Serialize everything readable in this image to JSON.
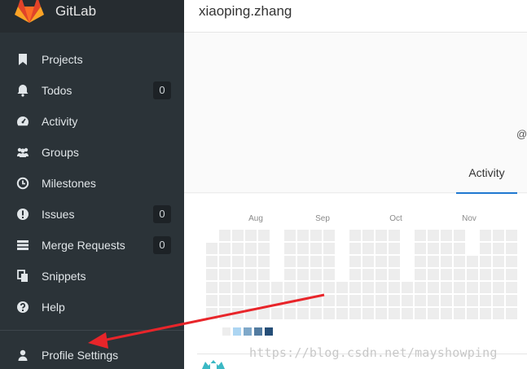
{
  "app": {
    "name": "GitLab"
  },
  "sidebar": {
    "items": [
      {
        "label": "Projects",
        "icon": "bookmark-icon",
        "badge": null
      },
      {
        "label": "Todos",
        "icon": "bell-icon",
        "badge": "0"
      },
      {
        "label": "Activity",
        "icon": "dashboard-icon",
        "badge": null
      },
      {
        "label": "Groups",
        "icon": "users-icon",
        "badge": null
      },
      {
        "label": "Milestones",
        "icon": "clock-icon",
        "badge": null
      },
      {
        "label": "Issues",
        "icon": "exclamation-circle-icon",
        "badge": "0"
      },
      {
        "label": "Merge Requests",
        "icon": "list-icon",
        "badge": "0"
      },
      {
        "label": "Snippets",
        "icon": "copy-icon",
        "badge": null
      },
      {
        "label": "Help",
        "icon": "question-circle-icon",
        "badge": null
      }
    ],
    "profile_settings": {
      "label": "Profile Settings",
      "icon": "user-icon"
    }
  },
  "header": {
    "username": "xiaoping.zhang"
  },
  "profile": {
    "at_sign": "@",
    "tabs": [
      {
        "label": "Activity",
        "active": true
      }
    ]
  },
  "calendar": {
    "months": [
      "Aug",
      "Sep",
      "Oct",
      "Nov"
    ],
    "legend_colors": [
      "#ededed",
      "#acd5f2",
      "#7fa8c9",
      "#527ba0",
      "#254e77"
    ]
  },
  "watermark": "https://blog.csdn.net/mayshowping",
  "colors": {
    "sidebar_bg": "#2b3338",
    "accent": "#1f78d1",
    "arrow": "#e8252a"
  }
}
